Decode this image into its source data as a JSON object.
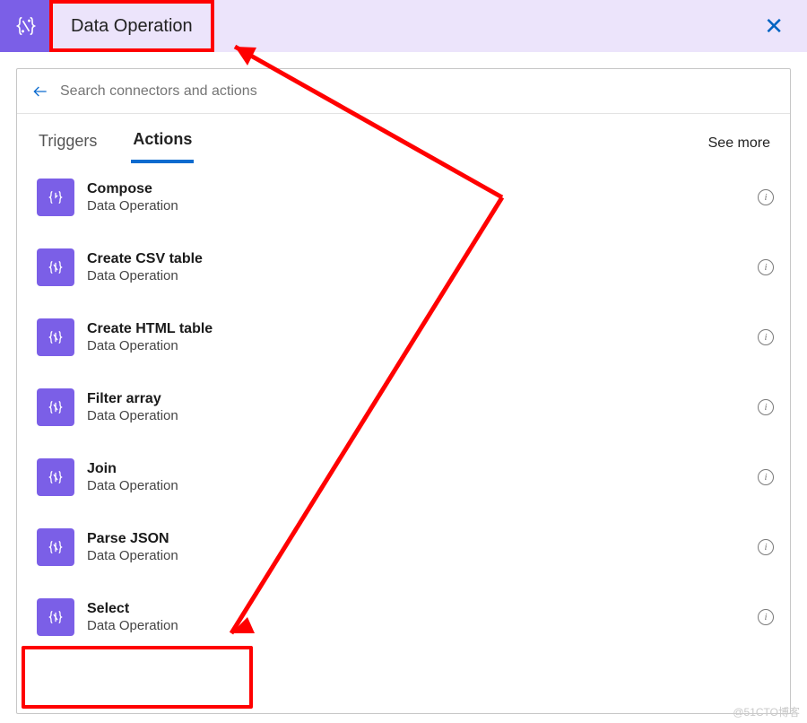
{
  "header": {
    "title": "Data Operation"
  },
  "search": {
    "placeholder": "Search connectors and actions"
  },
  "tabs": {
    "triggers": "Triggers",
    "actions": "Actions",
    "see_more": "See more"
  },
  "actions": [
    {
      "title": "Compose",
      "subtitle": "Data Operation"
    },
    {
      "title": "Create CSV table",
      "subtitle": "Data Operation"
    },
    {
      "title": "Create HTML table",
      "subtitle": "Data Operation"
    },
    {
      "title": "Filter array",
      "subtitle": "Data Operation"
    },
    {
      "title": "Join",
      "subtitle": "Data Operation"
    },
    {
      "title": "Parse JSON",
      "subtitle": "Data Operation"
    },
    {
      "title": "Select",
      "subtitle": "Data Operation"
    }
  ],
  "watermark": "@51CTO博客"
}
